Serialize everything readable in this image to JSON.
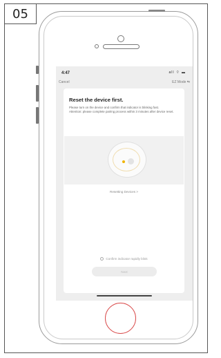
{
  "step_label": "05",
  "status_bar": {
    "time": "4:47",
    "icons": "all ⌔ ▬"
  },
  "nav": {
    "cancel_label": "Cancel",
    "mode_label": "EZ Mode ⇆"
  },
  "content": {
    "title": "Reset the device first.",
    "instructions": "Please turn on the device and confirm that indicator is blinking fast.",
    "attention": "Attention: please complete pairing process within 3 minutes after device reset.",
    "progress_label": "Resetting Devices >",
    "confirm_label": "Confirm indicator rapidly blink",
    "next_label": "Next"
  },
  "colors": {
    "home_button": "#d94b4b",
    "device_led": "#f0b400"
  }
}
